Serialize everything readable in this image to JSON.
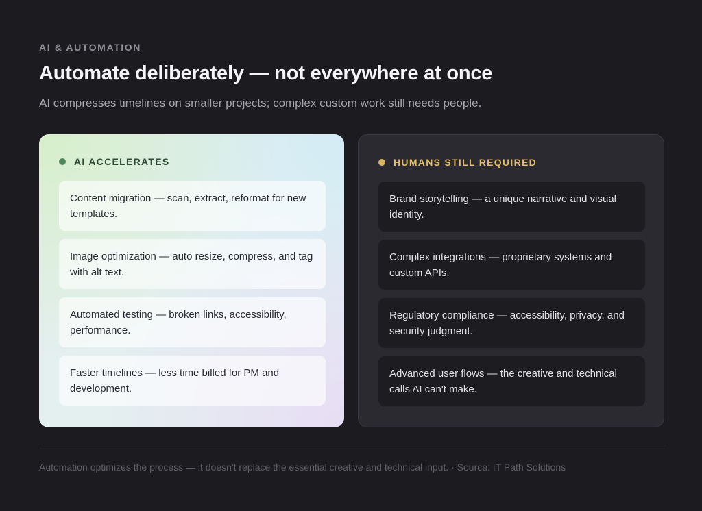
{
  "header": {
    "eyebrow": "AI & AUTOMATION",
    "title": "Automate deliberately — not everywhere at once",
    "subtitle": "AI compresses timelines on smaller projects; complex custom work still needs people."
  },
  "cards": {
    "ai": {
      "heading": "AI ACCELERATES",
      "dot_color": "#4f8a5c",
      "items": [
        "Content migration — scan, extract, reformat for new templates.",
        "Image optimization — auto resize, compress, and tag with alt text.",
        "Automated testing — broken links, accessibility, performance.",
        "Faster timelines — less time billed for PM and development."
      ]
    },
    "human": {
      "heading": "HUMANS STILL REQUIRED",
      "dot_color": "#d8b664",
      "items": [
        "Brand storytelling — a unique narrative and visual identity.",
        "Complex integrations — proprietary systems and custom APIs.",
        "Regulatory compliance — accessibility, privacy, and security judgment.",
        "Advanced user flows — the creative and technical calls AI can't make."
      ]
    }
  },
  "footer": {
    "text": "Automation optimizes the process — it doesn't replace the essential creative and technical input. · Source: IT Path Solutions"
  }
}
